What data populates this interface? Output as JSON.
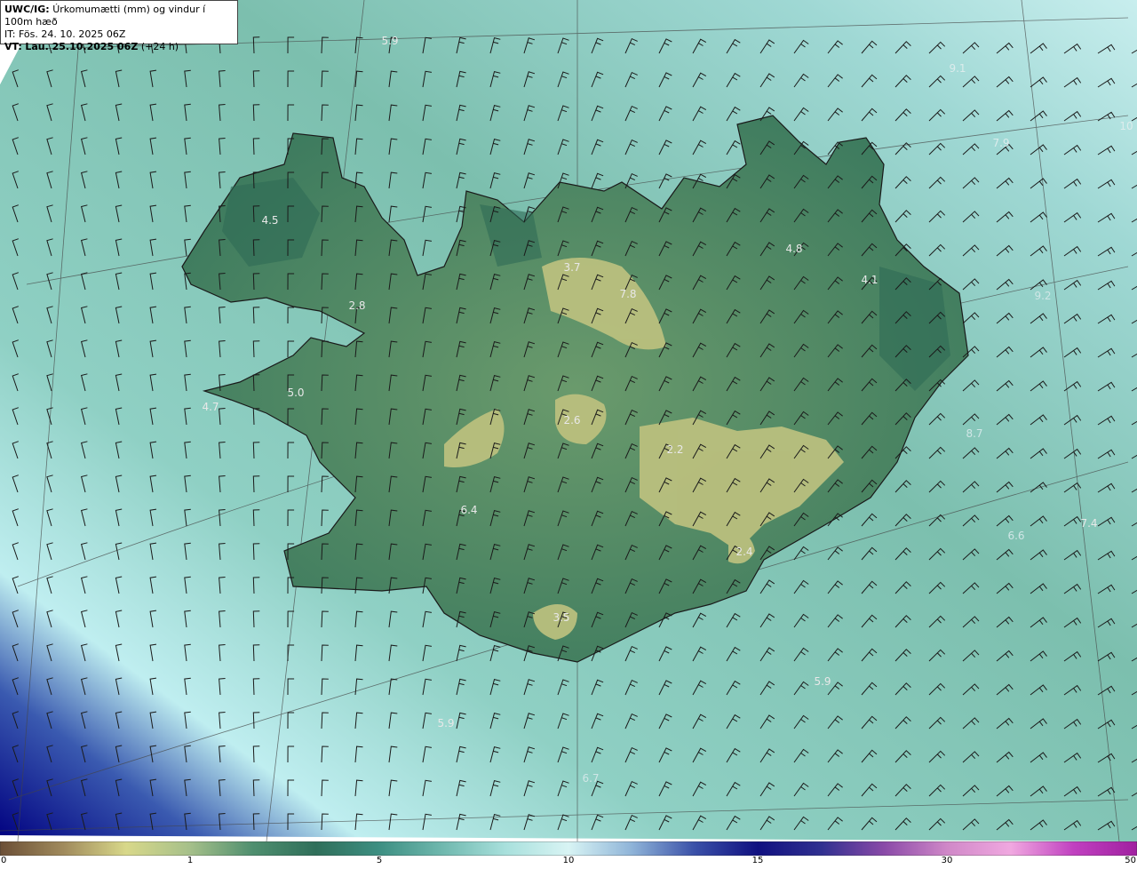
{
  "header": {
    "model": "UWC/IG:",
    "description": "Úrkomumætti (mm) og vindur í 100m hæð",
    "init_time": "IT: Fös. 24. 10. 2025 06Z",
    "valid_label": "VT:",
    "valid_time": "Lau. 25.10.2025 06Z",
    "lead": "(+24 h)"
  },
  "map_labels": [
    {
      "text": "5.9"
    },
    {
      "text": "9.1"
    },
    {
      "text": "7.9"
    },
    {
      "text": "10"
    },
    {
      "text": "4.5"
    },
    {
      "text": "3.7"
    },
    {
      "text": "7.8"
    },
    {
      "text": "4.8"
    },
    {
      "text": "4.1"
    },
    {
      "text": "2.8"
    },
    {
      "text": "5.0"
    },
    {
      "text": "4.7"
    },
    {
      "text": "2.6"
    },
    {
      "text": "2.2"
    },
    {
      "text": "6.4"
    },
    {
      "text": "2.4"
    },
    {
      "text": "3.5"
    },
    {
      "text": "5.9"
    },
    {
      "text": "5.9"
    },
    {
      "text": "7.4"
    },
    {
      "text": "9.2"
    },
    {
      "text": "8.7"
    },
    {
      "text": "6.6"
    },
    {
      "text": "6.7"
    }
  ],
  "colorbar": {
    "ticks": [
      "0",
      "1",
      "5",
      "10",
      "15",
      "30",
      "50"
    ],
    "colors": [
      "#6b4f36",
      "#a08a5c",
      "#d8d88a",
      "#a6c08a",
      "#4f8f6f",
      "#2f6f5a",
      "#3d8f82",
      "#6fb8ae",
      "#a8e0dc",
      "#d8f4f4",
      "#8fb4d8",
      "#3a50a8",
      "#101080",
      "#303090",
      "#8a4aa8",
      "#d088c8",
      "#f0a8e0",
      "#c040c0",
      "#a020a0"
    ],
    "color_notes": {
      "ocean": "#8fcfc4",
      "land_low": "#3f7f63",
      "land_high": "#c8c884",
      "coast": "#1a1a1a"
    }
  }
}
